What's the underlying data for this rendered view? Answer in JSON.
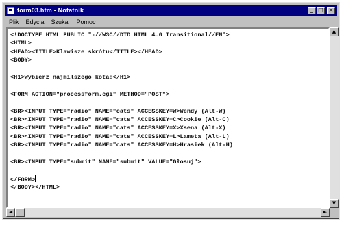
{
  "window": {
    "title": "form03.htm - Notatnik",
    "buttons": {
      "minimize": "_",
      "maximize": "□",
      "close": "×"
    }
  },
  "menu": [
    "Plik",
    "Edycja",
    "Szukaj",
    "Pomoc"
  ],
  "document": {
    "lines": [
      "<!DOCTYPE HTML PUBLIC \"-//W3C//DTD HTML 4.0 Transitional//EN\">",
      "<HTML>",
      "<HEAD><TITLE>Klawisze skrótu</TITLE></HEAD>",
      "<BODY>",
      "",
      "<H1>Wybierz najmilszego kota:</H1>",
      "",
      "<FORM ACTION=\"processform.cgi\" METHOD=\"POST\">",
      "",
      "<BR><INPUT TYPE=\"radio\" NAME=\"cats\" ACCESSKEY=W>Wendy (Alt-W)",
      "<BR><INPUT TYPE=\"radio\" NAME=\"cats\" ACCESSKEY=C>Cookie (Alt-C)",
      "<BR><INPUT TYPE=\"radio\" NAME=\"cats\" ACCESSKEY=X>Xsena (Alt-X)",
      "<BR><INPUT TYPE=\"radio\" NAME=\"cats\" ACCESSKEY=L>Lameta (Alt-L)",
      "<BR><INPUT TYPE=\"radio\" NAME=\"cats\" ACCESSKEY=H>Hrasiek (Alt-H)",
      "",
      "<BR><INPUT TYPE=\"submit\" NAME=\"submit\" VALUE=\"Głosuj\">",
      "",
      "</FORM>",
      "</BODY></HTML>"
    ],
    "caret_line": 17
  },
  "scrollbar": {
    "up": "▲",
    "down": "▼",
    "left": "◄",
    "right": "►"
  }
}
